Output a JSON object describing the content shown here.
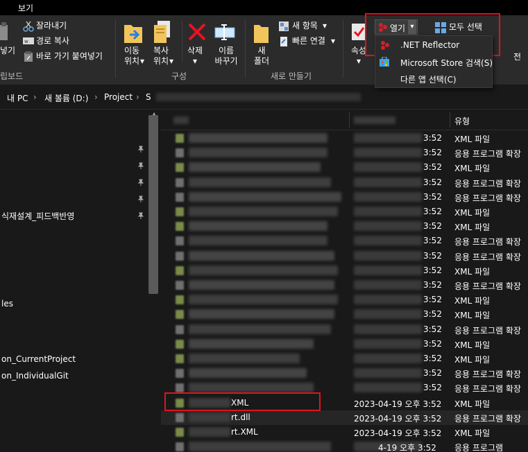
{
  "menubar": {
    "view_tab": "보기"
  },
  "ribbon": {
    "clipboard": {
      "cut": "잘라내기",
      "copy_path": "경로 복사",
      "paste_shortcut": "바로 가기 붙여넣기",
      "paste_partial": "넣기",
      "group_label": "립보드"
    },
    "organize": {
      "move_to_l1": "이동",
      "move_to_l2": "위치",
      "copy_to_l1": "복사",
      "copy_to_l2": "위치",
      "delete": "삭제",
      "rename_l1": "이름",
      "rename_l2": "바꾸기",
      "group_label": "구성"
    },
    "new": {
      "new_folder_l1": "새",
      "new_folder_l2": "폴더",
      "new_item": "새 항목",
      "easy_access": "빠른 연결",
      "group_label": "새로 만들기"
    },
    "open": {
      "properties_partial": "속성",
      "open_button": "열기",
      "select_all": "모두 선택",
      "partial_right": "전"
    }
  },
  "open_menu": {
    "items": [
      {
        "label": ".NET Reflector"
      },
      {
        "label": "Microsoft Store 검색(S)"
      },
      {
        "label": "다른 앱 선택(C)"
      }
    ]
  },
  "address": {
    "crumbs": [
      "내 PC",
      "새 볼륨 (D:)",
      "Project",
      "S"
    ]
  },
  "nav": {
    "items": [
      {
        "label": "식재설계_피드백반영"
      },
      {
        "label": "les"
      },
      {
        "label": "on_CurrentProject"
      },
      {
        "label": "on_IndividualGit"
      }
    ]
  },
  "columns": {
    "type": "유형"
  },
  "files": [
    {
      "time": "3:52",
      "type": "XML 파일"
    },
    {
      "time": "3:52",
      "type": "응용 프로그램 확장"
    },
    {
      "time": "3:52",
      "type": "XML 파일"
    },
    {
      "time": "3:52",
      "type": "응용 프로그램 확장"
    },
    {
      "time": "3:52",
      "type": "응용 프로그램 확장"
    },
    {
      "time": "3:52",
      "type": "XML 파일"
    },
    {
      "time": "3:52",
      "type": "XML 파일"
    },
    {
      "time": "3:52",
      "type": "응용 프로그램 확장"
    },
    {
      "time": "3:52",
      "type": "응용 프로그램 확장"
    },
    {
      "time": "3:52",
      "type": "XML 파일"
    },
    {
      "time": "3:52",
      "type": "응용 프로그램 확장"
    },
    {
      "time": "3:52",
      "type": "XML 파일"
    },
    {
      "time": "3:52",
      "type": "XML 파일"
    },
    {
      "time": "3:52",
      "type": "응용 프로그램 확장"
    },
    {
      "time": "3:52",
      "type": "XML 파일"
    },
    {
      "time": "3:52",
      "type": "XML 파일"
    },
    {
      "time": "3:52",
      "type": "응용 프로그램 확장"
    },
    {
      "time": "3:52",
      "type": "응용 프로그램 확장"
    },
    {
      "name_suffix": "XML",
      "date": "2023-04-19 오후 3:52",
      "type": "XML 파일"
    },
    {
      "name_suffix": "rt.dll",
      "date": "2023-04-19 오후 3:52",
      "type": "응용 프로그램 확장"
    },
    {
      "name_suffix": "rt.XML",
      "date": "2023-04-19 오후 3:52",
      "type": "XML 파일"
    },
    {
      "time": "4-19 오후 3:52",
      "type": "응용 프로그램"
    },
    {
      "time": "4-19 오후 3:52",
      "type": "응용 프로그램 확장"
    }
  ]
}
